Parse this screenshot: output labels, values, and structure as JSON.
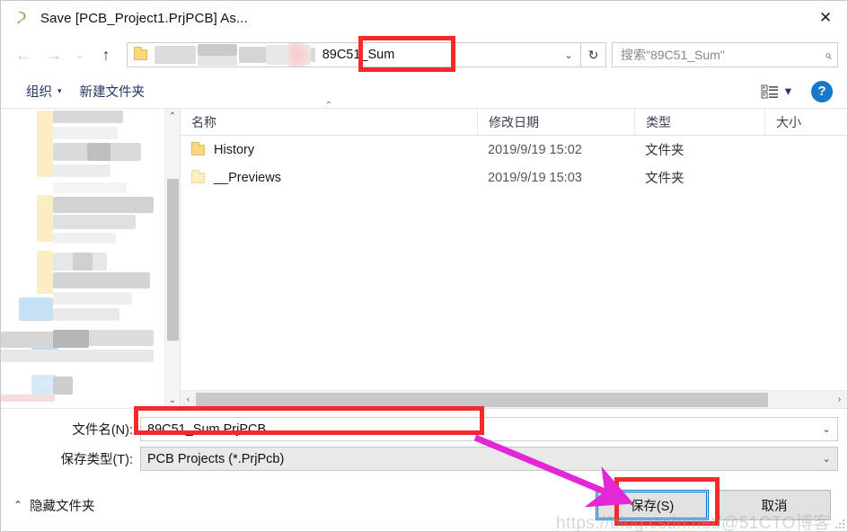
{
  "window": {
    "title": "Save [PCB_Project1.PrjPCB] As...",
    "app_icon": "altium-icon",
    "close_icon": "✕"
  },
  "nav": {
    "back_icon": "←",
    "forward_icon": "→",
    "recent_icon": "⌄",
    "up_icon": "↑",
    "address_value": "89C51_Sum",
    "address_chevron": "⌄",
    "refresh_icon": "↻",
    "search_placeholder": "搜索\"89C51_Sum\"",
    "search_icon": "⌕"
  },
  "commandbar": {
    "organize_label": "组织",
    "organize_caret": "▾",
    "new_folder_label": "新建文件夹",
    "view_icon": "list-view-icon",
    "view_caret": "▾",
    "help_label": "?"
  },
  "columns": {
    "name": "名称",
    "date": "修改日期",
    "type": "类型",
    "size": "大小",
    "sort_indicator": "⌃"
  },
  "files": [
    {
      "name": "History",
      "date": "2019/9/19 15:02",
      "type": "文件夹",
      "size": ""
    },
    {
      "name": "__Previews",
      "date": "2019/9/19 15:03",
      "type": "文件夹",
      "size": ""
    }
  ],
  "form": {
    "filename_label": "文件名(N):",
    "filename_value": "89C51_Sum.PrjPCB",
    "filetype_label": "保存类型(T):",
    "filetype_value": "PCB Projects (*.PrjPcb)",
    "chevron": "⌄"
  },
  "actions": {
    "hide_folders_label": "隐藏文件夹",
    "hide_folders_chevron": "⌃",
    "save_label": "保存(S)",
    "cancel_label": "取消"
  },
  "scroll": {
    "up_icon": "⌃",
    "down_icon": "⌄",
    "left_icon": "‹",
    "right_icon": "›"
  },
  "annotations": {
    "highlight_color": "#f42a2a",
    "arrow_color": "#e327d6",
    "watermark_text": "https://blog.csdn.net/@51CTO博客"
  }
}
